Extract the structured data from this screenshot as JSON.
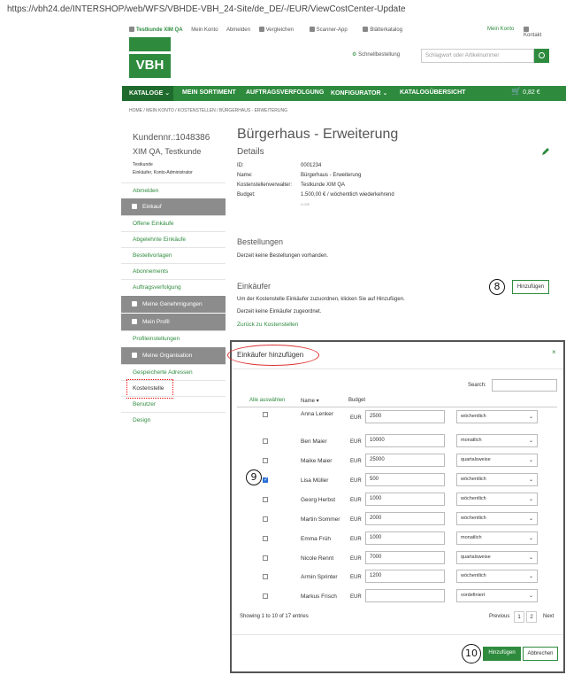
{
  "url": "https://vbh24.de/INTERSHOP/web/WFS/VBHDE-VBH_24-Site/de_DE/-/EUR/ViewCostCenter-Update",
  "topbar": {
    "user": "Testkunde XIM QA",
    "account": "Mein Konto",
    "logout": "Abmelden",
    "compare": "Vergleichen",
    "scanner": "Scanner-App",
    "catalog": "Blätterkatalog",
    "my_account": "Mein Konto",
    "contact": "Kontakt"
  },
  "logo": "VBH",
  "quick_order": "Schnellbestellung",
  "search_placeholder": "Schlagwort oder Artikelnummer",
  "nav": {
    "kataloge": "KATALOGE",
    "sortiment": "MEIN SORTIMENT",
    "auftrag": "AUFTRAGSVERFOLGUNG",
    "konfigurator": "KONFIGURATOR",
    "uebersicht": "KATALOGÜBERSICHT",
    "cart_total": "0,82 €"
  },
  "breadcrumb": "HOME  /  MEIN KONTO  /  KOSTENSTELLEN  /  BÜRGERHAUS - ERWEITERUNG",
  "sidebar": {
    "cust_nr": "Kundennr.:1048386",
    "cust_name": "XIM QA, Testkunde",
    "role1": "Testkunde",
    "role2": "Einkäufer, Konto-Administrator",
    "abmelden": "Abmelden",
    "einkauf": "Einkauf",
    "offene": "Offene Einkäufe",
    "abgelehnte": "Abgelehnte Einkäufe",
    "vorlagen": "Bestellvorlagen",
    "abos": "Abonnements",
    "auftragsverfolgung": "Auftragsverfolgung",
    "genehmigungen": "Meine Genehmigungen",
    "profil": "Mein Profil",
    "profileinst": "Profileinstellungen",
    "organisation": "Meine Organisation",
    "adressen": "Gespeicherte Adressen",
    "kostenstelle": "Kostenstelle",
    "benutzer": "Benutzer",
    "design": "Design"
  },
  "main": {
    "title": "Bürgerhaus - Erweiterung",
    "details": "Details",
    "id_label": "ID:",
    "id_value": "0001234",
    "name_label": "Name:",
    "name_value": "Bürgerhaus - Erweiterung",
    "verw_label": "Kostenstellenverwalter:",
    "verw_value": "Testkunde XIM QA",
    "budget_label": "Budget:",
    "budget_value": "1.500,00 € / wöchentlich wiederkehrend",
    "budget_sub": "0,00€",
    "bestellungen": "Bestellungen",
    "bestellungen_txt": "Derzeit keine Bestellungen vorhanden.",
    "einkaeufer": "Einkäufer",
    "einkaeufer_txt1": "Um der Kostenstelle Einkäufer zuzuordnen, klicken Sie auf Hinzufügen.",
    "einkaeufer_txt2": "Derzeit keine Einkäufer zugeordnet.",
    "zurueck": "Zurück zu Kostenstellen",
    "hinzufuegen": "Hinzufügen",
    "step8": "8"
  },
  "modal": {
    "title": "Einkäufer hinzufügen",
    "close": "×",
    "search_label": "Search:",
    "col_all": "Alle auswählen",
    "col_name": "Name ▾",
    "col_budget": "Budget",
    "rows": [
      {
        "name": "Anna Lenker",
        "currency": "EUR",
        "amount": "2500",
        "period": "wöchentlich",
        "checked": false
      },
      {
        "name": "Ben Maier",
        "currency": "EUR",
        "amount": "10000",
        "period": "monatlich",
        "checked": false
      },
      {
        "name": "Maike Maier",
        "currency": "EUR",
        "amount": "25000",
        "period": "quartalsweise",
        "checked": false
      },
      {
        "name": "Lisa Müller",
        "currency": "EUR",
        "amount": "500",
        "period": "wöchentlich",
        "checked": true
      },
      {
        "name": "Georg Herbst",
        "currency": "EUR",
        "amount": "1000",
        "period": "wöchentlich",
        "checked": false
      },
      {
        "name": "Martin Sommer",
        "currency": "EUR",
        "amount": "2000",
        "period": "wöchentlich",
        "checked": false
      },
      {
        "name": "Emma Früh",
        "currency": "EUR",
        "amount": "1000",
        "period": "monatlich",
        "checked": false
      },
      {
        "name": "Nicole Rennt",
        "currency": "EUR",
        "amount": "7000",
        "period": "quartalsweise",
        "checked": false
      },
      {
        "name": "Armin Sprinter",
        "currency": "EUR",
        "amount": "1200",
        "period": "wöchentlich",
        "checked": false
      },
      {
        "name": "Markus Frisch",
        "currency": "EUR",
        "amount": "",
        "period": "vordefiniert",
        "checked": false
      }
    ],
    "showing": "Showing 1 to 10 of 17 entries",
    "prev": "Previous",
    "page1": "1",
    "page2": "2",
    "next": "Next",
    "add": "Hinzufügen",
    "cancel": "Abbrechen",
    "step9": "9",
    "step10": "10"
  },
  "colors": {
    "brand": "#2e8b3e",
    "sidebar_head": "#8c8c8c",
    "annotation": "#d33"
  }
}
